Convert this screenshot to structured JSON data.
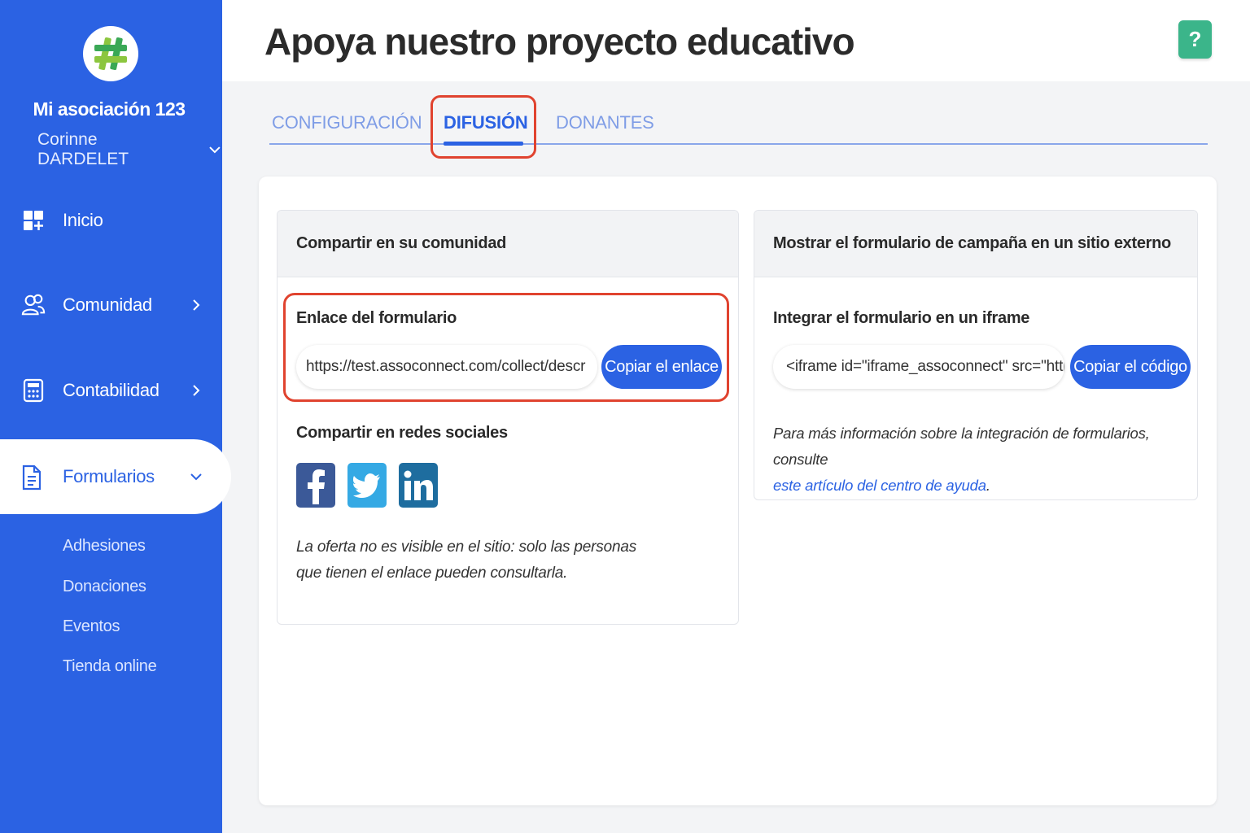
{
  "sidebar": {
    "org_name": "Mi asociación 123",
    "user_name": "Corinne DARDELET",
    "items": [
      {
        "label": "Inicio",
        "icon": "dashboard-icon"
      },
      {
        "label": "Comunidad",
        "icon": "users-icon"
      },
      {
        "label": "Contabilidad",
        "icon": "calculator-icon"
      },
      {
        "label": "Formularios",
        "icon": "document-icon"
      }
    ],
    "sub_items": [
      "Adhesiones",
      "Donaciones",
      "Eventos",
      "Tienda online"
    ]
  },
  "header": {
    "title": "Apoya nuestro proyecto educativo",
    "help_label": "?"
  },
  "tabs": [
    {
      "label": "CONFIGURACIÓN",
      "active": false
    },
    {
      "label": "DIFUSIÓN",
      "active": true
    },
    {
      "label": "DONANTES",
      "active": false
    }
  ],
  "share_card": {
    "title": "Compartir en su comunidad",
    "link_section_title": "Enlace del formulario",
    "link_value": "https://test.assoconnect.com/collect/descr",
    "copy_link_label": "Copiar el enlace",
    "social_section_title": "Compartir en redes sociales",
    "social_networks": [
      "facebook-icon",
      "twitter-icon",
      "linkedin-icon"
    ],
    "note_line1": "La oferta no es visible en el sitio: solo las personas",
    "note_line2": "que tienen el enlace pueden consultarla."
  },
  "embed_card": {
    "title": "Mostrar el formulario de campaña en un sitio externo",
    "iframe_section_title": "Integrar el formulario en un iframe",
    "iframe_value": "<iframe id=\"iframe_assoconnect\" src=\"http",
    "copy_code_label": "Copiar el código",
    "info_line1": "Para más información sobre la integración de formularios, consulte",
    "info_link": "este artículo del centro de ayuda",
    "info_end": "."
  },
  "colors": {
    "brand_blue": "#2b62e3",
    "help_green": "#3bb58a",
    "highlight_red": "#e0432f"
  }
}
